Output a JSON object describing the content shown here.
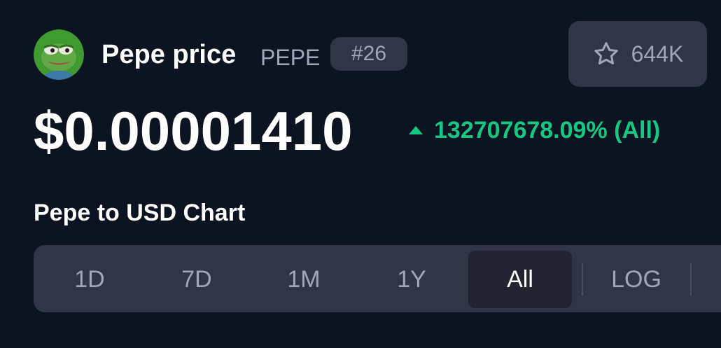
{
  "coin": {
    "name_label": "Pepe price",
    "symbol": "PEPE",
    "rank": "#26",
    "watchlist_count": "644K",
    "price": "$0.00001410",
    "change": "132707678.09% (All)"
  },
  "chart_section": {
    "title": "Pepe to USD Chart",
    "ranges": [
      "1D",
      "7D",
      "1M",
      "1Y",
      "All"
    ],
    "selected_range": "All",
    "log_label": "LOG"
  },
  "colors": {
    "background": "#0d1421",
    "surface": "#323546",
    "positive": "#16c784",
    "muted_text": "#a1a7bb"
  },
  "icons": {
    "logo": "pepe-frog-logo-icon",
    "watch": "star-icon",
    "change_direction": "caret-up-icon"
  }
}
